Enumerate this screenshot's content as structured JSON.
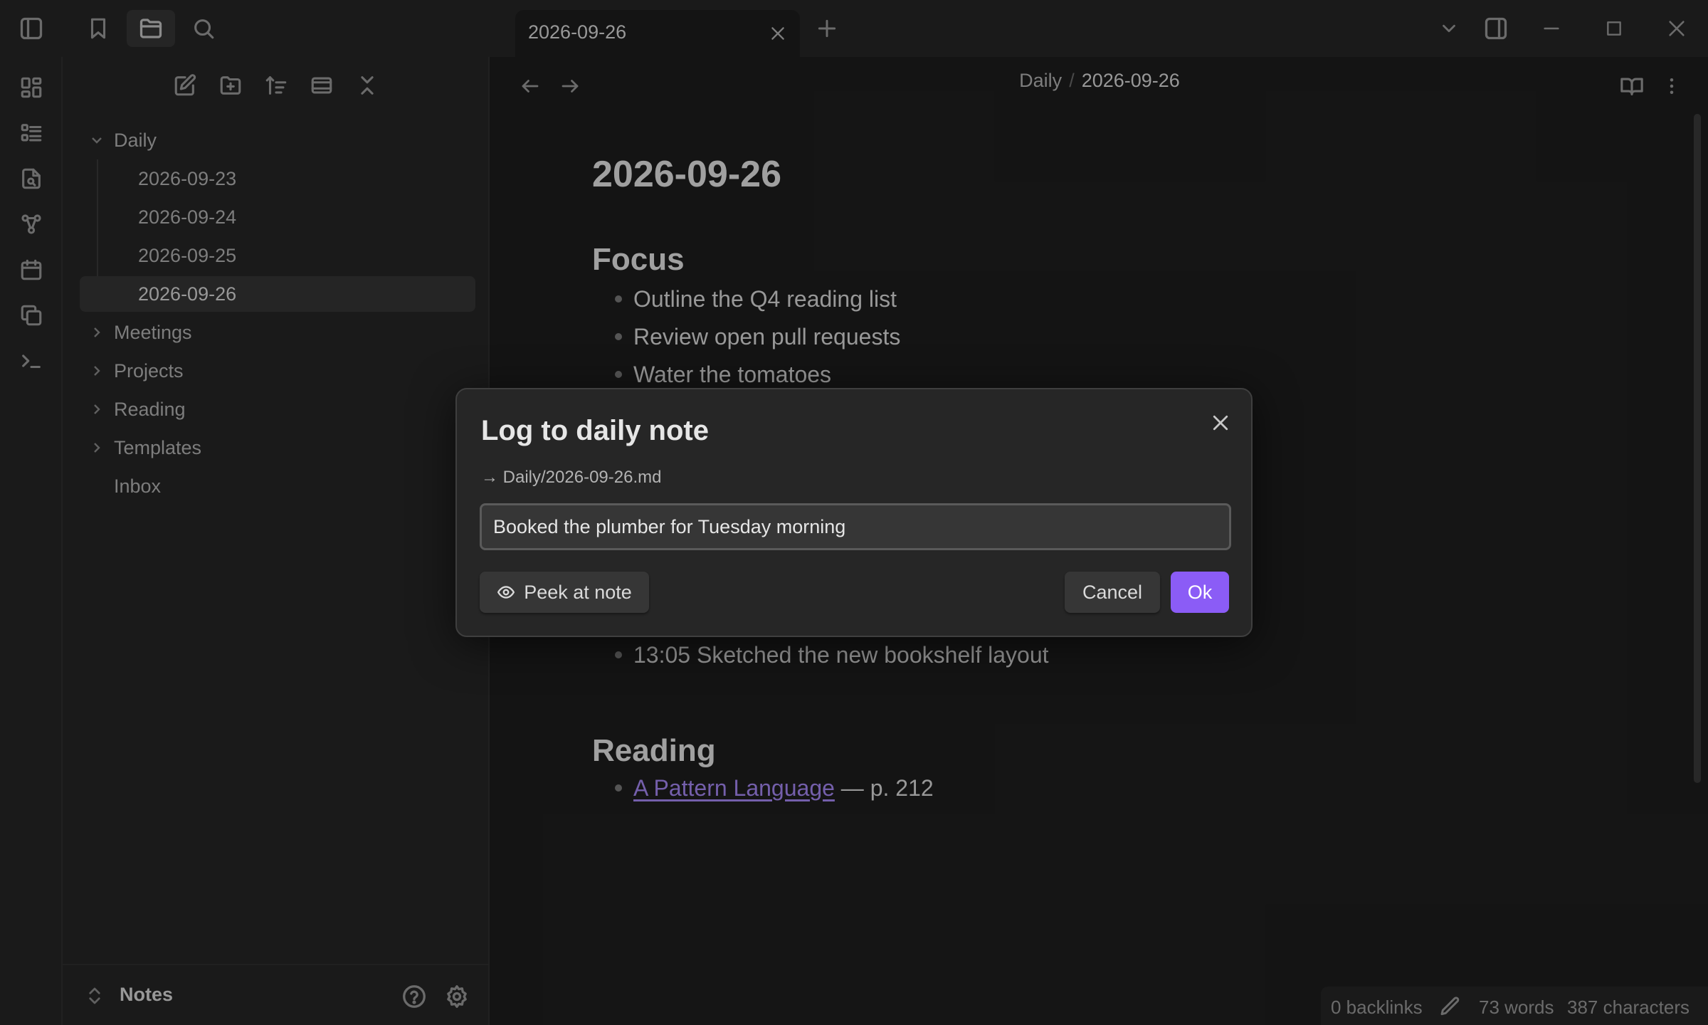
{
  "tab": {
    "title": "2026-09-26"
  },
  "sidebar": {
    "tree": [
      {
        "label": "Daily",
        "kind": "folder",
        "expanded": true
      },
      {
        "label": "2026-09-23",
        "kind": "file"
      },
      {
        "label": "2026-09-24",
        "kind": "file"
      },
      {
        "label": "2026-09-25",
        "kind": "file"
      },
      {
        "label": "2026-09-26",
        "kind": "file",
        "active": true
      },
      {
        "label": "Meetings",
        "kind": "folder",
        "expanded": false
      },
      {
        "label": "Projects",
        "kind": "folder",
        "expanded": false
      },
      {
        "label": "Reading",
        "kind": "folder",
        "expanded": false
      },
      {
        "label": "Templates",
        "kind": "folder",
        "expanded": false
      },
      {
        "label": "Inbox",
        "kind": "file"
      }
    ],
    "vault_name": "Notes"
  },
  "breadcrumb": {
    "folder": "Daily",
    "separator": "/",
    "note": "2026-09-26"
  },
  "note": {
    "title": "2026-09-26",
    "focus_heading": "Focus",
    "focus_items": [
      "Outline the Q4 reading list",
      "Review open pull requests",
      "Water the tomatoes"
    ],
    "log_item": "13:05 Sketched the new bookshelf layout",
    "reading_heading": "Reading",
    "reading_link": "A Pattern Language",
    "reading_suffix": " — p. 212"
  },
  "modal": {
    "title": "Log to daily note",
    "path": "→ Daily/2026-09-26.md",
    "input_value": "Booked the plumber for Tuesday morning",
    "peek_label": "Peek at note",
    "cancel_label": "Cancel",
    "ok_label": "Ok"
  },
  "status": {
    "backlinks": "0 backlinks",
    "words": "73 words",
    "characters": "387 characters"
  },
  "colors": {
    "accent": "#8b5cf6",
    "link": "#a688f5",
    "background": "#1e1e1e",
    "panel": "#262626"
  }
}
